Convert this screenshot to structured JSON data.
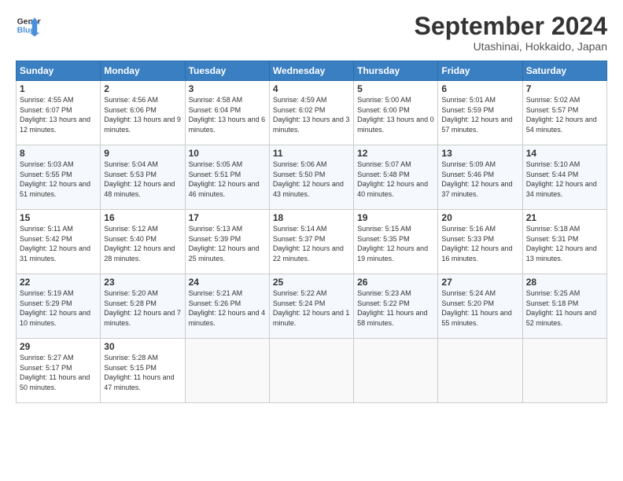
{
  "header": {
    "logo_line1": "General",
    "logo_line2": "Blue",
    "month_title": "September 2024",
    "location": "Utashinai, Hokkaido, Japan"
  },
  "days_of_week": [
    "Sunday",
    "Monday",
    "Tuesday",
    "Wednesday",
    "Thursday",
    "Friday",
    "Saturday"
  ],
  "weeks": [
    [
      {
        "day": "1",
        "sunrise": "4:55 AM",
        "sunset": "6:07 PM",
        "daylight": "13 hours and 12 minutes."
      },
      {
        "day": "2",
        "sunrise": "4:56 AM",
        "sunset": "6:06 PM",
        "daylight": "13 hours and 9 minutes."
      },
      {
        "day": "3",
        "sunrise": "4:58 AM",
        "sunset": "6:04 PM",
        "daylight": "13 hours and 6 minutes."
      },
      {
        "day": "4",
        "sunrise": "4:59 AM",
        "sunset": "6:02 PM",
        "daylight": "13 hours and 3 minutes."
      },
      {
        "day": "5",
        "sunrise": "5:00 AM",
        "sunset": "6:00 PM",
        "daylight": "13 hours and 0 minutes."
      },
      {
        "day": "6",
        "sunrise": "5:01 AM",
        "sunset": "5:59 PM",
        "daylight": "12 hours and 57 minutes."
      },
      {
        "day": "7",
        "sunrise": "5:02 AM",
        "sunset": "5:57 PM",
        "daylight": "12 hours and 54 minutes."
      }
    ],
    [
      {
        "day": "8",
        "sunrise": "5:03 AM",
        "sunset": "5:55 PM",
        "daylight": "12 hours and 51 minutes."
      },
      {
        "day": "9",
        "sunrise": "5:04 AM",
        "sunset": "5:53 PM",
        "daylight": "12 hours and 48 minutes."
      },
      {
        "day": "10",
        "sunrise": "5:05 AM",
        "sunset": "5:51 PM",
        "daylight": "12 hours and 46 minutes."
      },
      {
        "day": "11",
        "sunrise": "5:06 AM",
        "sunset": "5:50 PM",
        "daylight": "12 hours and 43 minutes."
      },
      {
        "day": "12",
        "sunrise": "5:07 AM",
        "sunset": "5:48 PM",
        "daylight": "12 hours and 40 minutes."
      },
      {
        "day": "13",
        "sunrise": "5:09 AM",
        "sunset": "5:46 PM",
        "daylight": "12 hours and 37 minutes."
      },
      {
        "day": "14",
        "sunrise": "5:10 AM",
        "sunset": "5:44 PM",
        "daylight": "12 hours and 34 minutes."
      }
    ],
    [
      {
        "day": "15",
        "sunrise": "5:11 AM",
        "sunset": "5:42 PM",
        "daylight": "12 hours and 31 minutes."
      },
      {
        "day": "16",
        "sunrise": "5:12 AM",
        "sunset": "5:40 PM",
        "daylight": "12 hours and 28 minutes."
      },
      {
        "day": "17",
        "sunrise": "5:13 AM",
        "sunset": "5:39 PM",
        "daylight": "12 hours and 25 minutes."
      },
      {
        "day": "18",
        "sunrise": "5:14 AM",
        "sunset": "5:37 PM",
        "daylight": "12 hours and 22 minutes."
      },
      {
        "day": "19",
        "sunrise": "5:15 AM",
        "sunset": "5:35 PM",
        "daylight": "12 hours and 19 minutes."
      },
      {
        "day": "20",
        "sunrise": "5:16 AM",
        "sunset": "5:33 PM",
        "daylight": "12 hours and 16 minutes."
      },
      {
        "day": "21",
        "sunrise": "5:18 AM",
        "sunset": "5:31 PM",
        "daylight": "12 hours and 13 minutes."
      }
    ],
    [
      {
        "day": "22",
        "sunrise": "5:19 AM",
        "sunset": "5:29 PM",
        "daylight": "12 hours and 10 minutes."
      },
      {
        "day": "23",
        "sunrise": "5:20 AM",
        "sunset": "5:28 PM",
        "daylight": "12 hours and 7 minutes."
      },
      {
        "day": "24",
        "sunrise": "5:21 AM",
        "sunset": "5:26 PM",
        "daylight": "12 hours and 4 minutes."
      },
      {
        "day": "25",
        "sunrise": "5:22 AM",
        "sunset": "5:24 PM",
        "daylight": "12 hours and 1 minute."
      },
      {
        "day": "26",
        "sunrise": "5:23 AM",
        "sunset": "5:22 PM",
        "daylight": "11 hours and 58 minutes."
      },
      {
        "day": "27",
        "sunrise": "5:24 AM",
        "sunset": "5:20 PM",
        "daylight": "11 hours and 55 minutes."
      },
      {
        "day": "28",
        "sunrise": "5:25 AM",
        "sunset": "5:18 PM",
        "daylight": "11 hours and 52 minutes."
      }
    ],
    [
      {
        "day": "29",
        "sunrise": "5:27 AM",
        "sunset": "5:17 PM",
        "daylight": "11 hours and 50 minutes."
      },
      {
        "day": "30",
        "sunrise": "5:28 AM",
        "sunset": "5:15 PM",
        "daylight": "11 hours and 47 minutes."
      },
      null,
      null,
      null,
      null,
      null
    ]
  ]
}
